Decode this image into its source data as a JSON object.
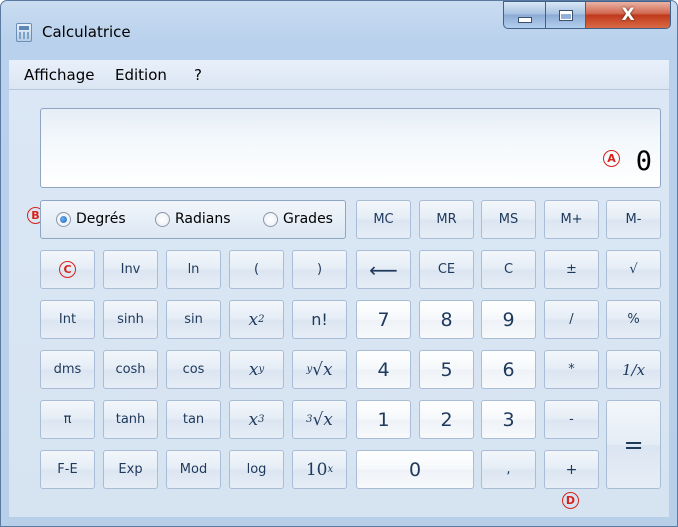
{
  "window": {
    "title": "Calculatrice",
    "close_label": "X",
    "colors": {
      "frame": "#b9d1ec",
      "close": "#c0391c",
      "annotation": "#d8221a"
    }
  },
  "menu": [
    "Affichage",
    "Edition",
    "?"
  ],
  "display": {
    "value": "0"
  },
  "annotations": {
    "a": "A",
    "b": "B",
    "c": "C",
    "d": "D"
  },
  "angle_units": {
    "options": [
      {
        "label": "Degrés",
        "checked": true
      },
      {
        "label": "Radians",
        "checked": false
      },
      {
        "label": "Grades",
        "checked": false
      }
    ]
  },
  "memory": [
    "MC",
    "MR",
    "MS",
    "M+",
    "M-"
  ],
  "keys": {
    "row2": [
      "",
      "Inv",
      "ln",
      "(",
      ")",
      "⟵",
      "CE",
      "C",
      "±",
      "√"
    ],
    "row3": [
      "Int",
      "sinh",
      "sin",
      "x",
      "2",
      "n!",
      "7",
      "8",
      "9",
      "/",
      "%"
    ],
    "row4": [
      "dms",
      "cosh",
      "cos",
      "x",
      "y",
      "y",
      "√x",
      "4",
      "5",
      "6",
      "*",
      "1/x"
    ],
    "row5": [
      "π",
      "tanh",
      "tan",
      "x",
      "3",
      "3",
      "√x",
      "1",
      "2",
      "3",
      "-",
      "="
    ],
    "row6": [
      "F-E",
      "Exp",
      "Mod",
      "log",
      "10",
      "x",
      "0",
      ",",
      "+"
    ]
  }
}
